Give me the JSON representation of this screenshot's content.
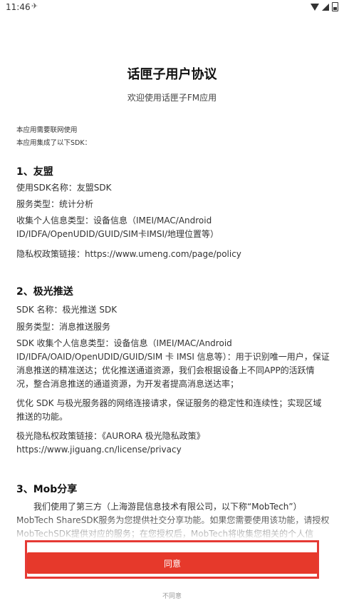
{
  "status_bar": {
    "time": "11:46",
    "extra": "✈"
  },
  "header": {
    "title": "话匣子用户协议",
    "subtitle": "欢迎使用话匣子FM应用"
  },
  "intro": {
    "line1": "本应用需要联网使用",
    "line2": "本应用集成了以下SDK："
  },
  "sections": {
    "s1": {
      "title": "1、友盟",
      "p1": "使用SDK名称：友盟SDK",
      "p2": "服务类型：统计分析",
      "p3": "收集个人信息类型：设备信息（IMEI/MAC/Android ID/IDFA/OpenUDID/GUID/SIM卡IMSI/地理位置等）",
      "p4": "隐私权政策链接：https://www.umeng.com/page/policy"
    },
    "s2": {
      "title": "2、极光推送",
      "p1": "SDK 名称：极光推送 SDK",
      "p2": "服务类型：消息推送服务",
      "p3": "SDK 收集个人信息类型：设备信息（IMEI/MAC/Android ID/IDFA/OAID/OpenUDID/GUID/SIM 卡 IMSI 信息等）：用于识别唯一用户，保证消息推送的精准送达；优化推送通道资源，我们会根据设备上不同APP的活跃情况，整合消息推送的通道资源，为开发者提高消息送达率；",
      "p4": "优化 SDK 与极光服务器的网络连接请求，保证服务的稳定性和连续性；实现区域推送的功能。",
      "p5": "极光隐私权政策链接：《AURORA 极光隐私政策》 https://www.jiguang.cn/license/privacy"
    },
    "s3": {
      "title": "3、Mob分享",
      "p1": "我们使用了第三方（上海游昆信息技术有限公司，以下称“MobTech”）MobTech ShareSDK服务为您提供社交分享功能。如果您需要使用该功能，请授权MobTechSDK提供对应的服务；在您授权后，MobTech将收集您相关的个人信息，关于MobTech所收集的信息种类、用途、个人信息保护的规则及"
    }
  },
  "actions": {
    "agree": "同意",
    "disagree": "不同意"
  },
  "colors": {
    "accent": "#e6392b",
    "highlight_border": "#e53a35"
  }
}
